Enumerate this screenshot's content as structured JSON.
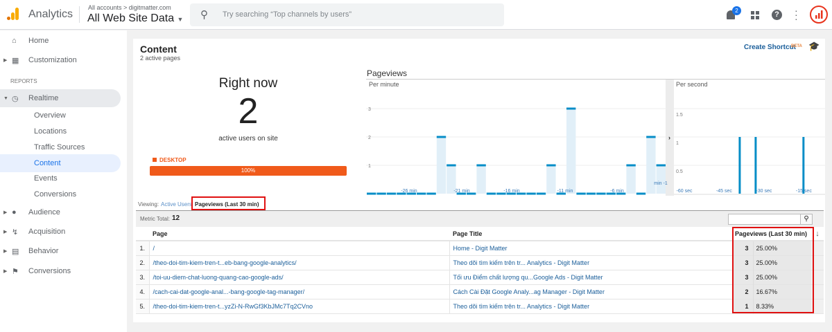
{
  "topbar": {
    "app_name": "Analytics",
    "breadcrumb": "All accounts > digitmatter.com",
    "property": "All Web Site Data",
    "search_placeholder": "Try searching “Top channels by users”",
    "notification_count": "2"
  },
  "sidebar": {
    "home": "Home",
    "customization": "Customization",
    "reports_heading": "REPORTS",
    "realtime": "Realtime",
    "realtime_items": [
      "Overview",
      "Locations",
      "Traffic Sources",
      "Content",
      "Events",
      "Conversions"
    ],
    "audience": "Audience",
    "acquisition": "Acquisition",
    "behavior": "Behavior",
    "conversions": "Conversions"
  },
  "content": {
    "title": "Content",
    "subtitle": "2 active pages",
    "create_shortcut": "Create Shortcut",
    "beta": "BETA",
    "right_now": "Right now",
    "active_users": "2",
    "active_users_label": "active users on site",
    "device_label": "DESKTOP",
    "device_percent": "100%",
    "device_fraction": 1.0
  },
  "viewing": {
    "label": "Viewing:",
    "tab_active_users": "Active Users",
    "tab_pageviews": "Pageviews (Last 30 min)"
  },
  "table": {
    "metric_total_label": "Metric Total:",
    "metric_total": "12",
    "columns": [
      "Page",
      "Page Title",
      "Pageviews (Last 30 min)"
    ],
    "rows": [
      {
        "n": "1.",
        "page": "/",
        "title": "Home - Digit Matter",
        "views": "3",
        "pct": "25.00%"
      },
      {
        "n": "2.",
        "page": "/theo-doi-tim-kiem-tren-t...eb-bang-google-analytics/",
        "title": "Theo dõi tìm kiếm trên tr... Analytics - Digit Matter",
        "views": "3",
        "pct": "25.00%"
      },
      {
        "n": "3.",
        "page": "/toi-uu-diem-chat-luong-quang-cao-google-ads/",
        "title": "Tối ưu Điểm chất lượng qu...Google Ads - Digit Matter",
        "views": "3",
        "pct": "25.00%"
      },
      {
        "n": "4.",
        "page": "/cach-cai-dat-google-anal...-bang-google-tag-manager/",
        "title": "Cách Cài Đặt Google Analy...ag Manager - Digit Matter",
        "views": "2",
        "pct": "16.67%"
      },
      {
        "n": "5.",
        "page": "/theo-doi-tim-kiem-tren-t...yzZi-N-RwGf3KbJMc7Tq2CVno",
        "title": "Theo dõi tìm kiếm trên tr... Analytics - Digit Matter",
        "views": "1",
        "pct": "8.33%"
      }
    ]
  },
  "chart_data": [
    {
      "type": "bar",
      "title": "Pageviews",
      "subtitle": "Per minute",
      "x_tick_labels": [
        "-26 min",
        "-21 min",
        "-16 min",
        "-11 min",
        "-6 min",
        "min -1"
      ],
      "y_ticks": [
        "1",
        "2",
        "3"
      ],
      "ylim": [
        0,
        3.5
      ],
      "x": [
        -30,
        -29,
        -28,
        -27,
        -26,
        -25,
        -24,
        -23,
        -22,
        -21,
        -20,
        -19,
        -18,
        -17,
        -16,
        -15,
        -14,
        -13,
        -12,
        -11,
        -10,
        -9,
        -8,
        -7,
        -6,
        -5,
        -4,
        -3,
        -2,
        -1
      ],
      "values": [
        0,
        0,
        0,
        0,
        0,
        0,
        0,
        2,
        1,
        0,
        0,
        1,
        0,
        0,
        0,
        0,
        0,
        0,
        1,
        0,
        3,
        0,
        0,
        0,
        0,
        0,
        1,
        0,
        2,
        1
      ],
      "colors": {
        "bar": "#058dc7",
        "fill": "#e1eff8"
      }
    },
    {
      "type": "bar",
      "subtitle": "Per second",
      "x_tick_labels": [
        "-60 sec",
        "-45 sec",
        "-30 sec",
        "-15 sec"
      ],
      "y_ticks": [
        "0.5",
        "1",
        "1.5"
      ],
      "ylim": [
        0,
        2
      ],
      "x_seconds": [
        -36,
        -30,
        -12
      ],
      "values": [
        1,
        1,
        1
      ]
    }
  ]
}
